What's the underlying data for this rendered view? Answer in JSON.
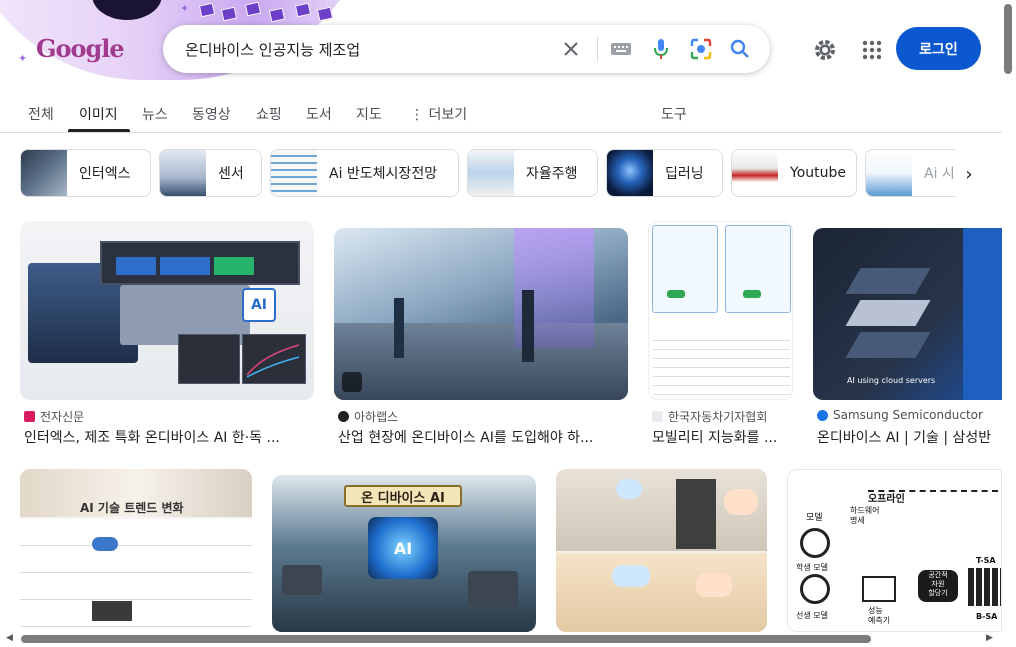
{
  "search": {
    "query": "온디바이스 인공지능 제조업",
    "placeholder": ""
  },
  "doodle": {
    "logo": "Google"
  },
  "header": {
    "login_label": "로그인"
  },
  "tabs": [
    {
      "label": "전체"
    },
    {
      "label": "이미지"
    },
    {
      "label": "뉴스"
    },
    {
      "label": "동영상"
    },
    {
      "label": "쇼핑"
    },
    {
      "label": "도서"
    },
    {
      "label": "지도"
    },
    {
      "label": "더보기"
    }
  ],
  "tools_label": "도구",
  "chips": [
    {
      "label": "인터엑스"
    },
    {
      "label": "센서"
    },
    {
      "label": "Ai 반도체시장전망"
    },
    {
      "label": "자율주행"
    },
    {
      "label": "딥러닝"
    },
    {
      "label": "Youtube"
    },
    {
      "label": "Ai 시"
    }
  ],
  "results_row1": [
    {
      "source": "전자신문",
      "title": "인터엑스, 제조 특화 온디바이스 AI 한·독 ..."
    },
    {
      "source": "아하랩스",
      "title": "산업 현장에 온디바이스 AI를 도입해야 하..."
    },
    {
      "source": "한국자동차기자협회",
      "title": "모빌리티 지능화를 ..."
    },
    {
      "source": "Samsung Semiconductor",
      "title": "온디바이스 AI | 기술 | 삼성반"
    }
  ],
  "image_text": {
    "r1_ai_badge": "AI",
    "r2_cloud": "AI using cloud servers",
    "r2_1_heading": "AI 기술 트렌드 변화",
    "r2_2_heading": "온 디바이스 AI",
    "r2_2_chip": "AI",
    "r2_4_offline": "오프라인",
    "r2_4_model": "모델",
    "r2_4_hw": "하드웨어\n명세",
    "r2_4_learn": "학생 모델",
    "r2_4_teacher": "선생 모델",
    "r2_4_predict": "성능\n예측기",
    "r2_4_alloc": "공간적\n자원\n할당기",
    "r2_4_tsa": "T-SA",
    "r2_4_bsa": "B-SA"
  },
  "colors": {
    "accent": "#0b57d0",
    "doodle": "#c9a9f0"
  }
}
